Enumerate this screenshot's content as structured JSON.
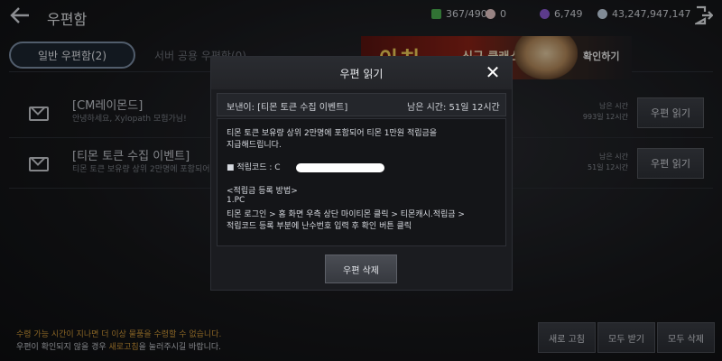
{
  "header": {
    "title": "우편함",
    "resources": [
      {
        "icon": "inventory-icon",
        "value": "367/490",
        "color": "#4caf50"
      },
      {
        "icon": "pearl-icon",
        "value": "0",
        "color": "#e8c9c9"
      },
      {
        "icon": "gem-icon",
        "value": "6,749",
        "color": "#8e5bd6"
      },
      {
        "icon": "coin-icon",
        "value": "43,247,947,147",
        "color": "#c7d6e6"
      }
    ]
  },
  "tabs": [
    {
      "label": "일반 우편함(2)"
    },
    {
      "label": "서버 공용 우편함(0)"
    }
  ],
  "banner": {
    "title": "아치",
    "subtitle": "신규 클래스",
    "button": "확인하기"
  },
  "mails": [
    {
      "title": "[CM레이몬드]",
      "preview": "안녕하세요, Xylopath 모험가님!",
      "remain_label": "남은 시간",
      "remain_value": "993일 12시간",
      "button": "우편 읽기"
    },
    {
      "title": "[티몬 토큰 수집 이벤트]",
      "preview": "티몬 토큰 보유량 상위 2만명에 포함되어",
      "remain_label": "남은 시간",
      "remain_value": "51일 12시간",
      "button": "우편 읽기"
    }
  ],
  "modal": {
    "title": "우편 읽기",
    "sender": "보낸이: [티몬 토큰 수집 이벤트]",
    "remaining": "남은 시간: 51일 12시간",
    "body": {
      "line1": "티몬 토큰 보유량 상위 2만명에 포함되어 티몬 1만원 적립금을",
      "line2": "지급해드립니다.",
      "code_label": "■ 적립코드 : ",
      "code_prefix": "C",
      "steps_title": "<적립금 등록 방법>",
      "step_pc": "1.PC",
      "step_path": "티몬 로그인 > 홈 화면 우측 상단 마이티몬 클릭 > 티몬캐시.적립금 >",
      "step_path2": "적립코드 등록 부분에 난수번호 입력 후 확인 버튼 클릭"
    },
    "delete_button": "우편 삭제"
  },
  "footer": {
    "notice1": "수령 가능 시간이 지나면 더 이상 물품을 수령할 수 없습니다.",
    "notice2_pre": "우편이 확인되지 않을 경우 ",
    "notice2_hl": "새로고침",
    "notice2_post": "을 눌러주시길 바랍니다.",
    "refresh_button": "새로 고침",
    "receive_all_button": "모두 받기",
    "delete_all_button": "모두 삭제"
  }
}
